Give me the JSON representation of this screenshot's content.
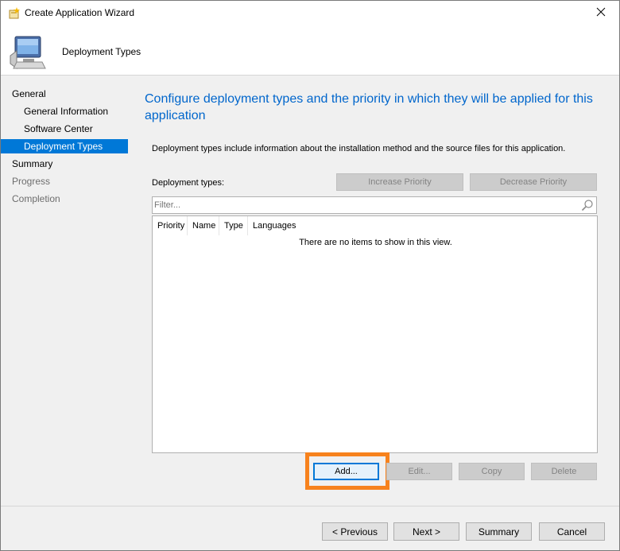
{
  "window": {
    "title": "Create Application Wizard",
    "close_icon": "close-icon",
    "wizard_icon": "wizard-icon"
  },
  "header": {
    "title": "Deployment Types",
    "icon": "computer-icon"
  },
  "nav": {
    "items": [
      {
        "label": "General",
        "level": "top",
        "state": "normal"
      },
      {
        "label": "General Information",
        "level": "sub",
        "state": "normal"
      },
      {
        "label": "Software Center",
        "level": "sub",
        "state": "normal"
      },
      {
        "label": "Deployment Types",
        "level": "sub",
        "state": "selected"
      },
      {
        "label": "Summary",
        "level": "top",
        "state": "normal"
      },
      {
        "label": "Progress",
        "level": "top",
        "state": "disabled"
      },
      {
        "label": "Completion",
        "level": "top",
        "state": "disabled"
      }
    ]
  },
  "main": {
    "title": "Configure deployment types and the priority in which they will be applied for this application",
    "description": "Deployment types include information about the installation method and the source files for this application.",
    "deployment_types_label": "Deployment types:",
    "increase_priority": "Increase Priority",
    "decrease_priority": "Decrease Priority",
    "filter_placeholder": "Filter...",
    "columns": [
      "Priority",
      "Name",
      "Type",
      "Languages"
    ],
    "empty_message": "There are no items to show in this view.",
    "add": "Add...",
    "edit": "Edit...",
    "copy": "Copy",
    "delete": "Delete"
  },
  "footer": {
    "previous": "< Previous",
    "next": "Next >",
    "summary": "Summary",
    "cancel": "Cancel"
  },
  "colors": {
    "accent": "#0078d7",
    "title_blue": "#0066cc",
    "highlight": "#f7821d"
  }
}
